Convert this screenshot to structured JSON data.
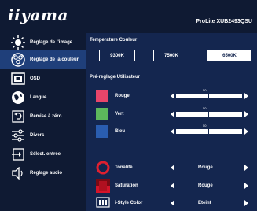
{
  "header": {
    "logo": "iiyama",
    "model": "ProLite XUB2493QSU"
  },
  "sidebar": {
    "items": [
      {
        "label": "Réglage de l'image",
        "icon": "brightness-icon",
        "active": false
      },
      {
        "label": "Réglage de la couleur",
        "icon": "color-palette-icon",
        "active": true
      },
      {
        "label": "OSD",
        "icon": "osd-icon",
        "active": false
      },
      {
        "label": "Langue",
        "icon": "globe-icon",
        "active": false
      },
      {
        "label": "Remise à zéro",
        "icon": "reset-icon",
        "active": false
      },
      {
        "label": "Divers",
        "icon": "sliders-icon",
        "active": false
      },
      {
        "label": "Sélect. entrée",
        "icon": "input-select-icon",
        "active": false
      },
      {
        "label": "Réglage audio",
        "icon": "speaker-icon",
        "active": false
      }
    ]
  },
  "main": {
    "temp_title": "Temperature Couleur",
    "temp_options": [
      {
        "label": "9300K",
        "selected": false
      },
      {
        "label": "7500K",
        "selected": false
      },
      {
        "label": "6500K",
        "selected": true
      }
    ],
    "user_title": "Pré-reglage Utilisateur",
    "rgb": [
      {
        "label": "Rouge",
        "value": "50",
        "color": "#e8456a"
      },
      {
        "label": "Vert",
        "value": "50",
        "color": "#5cb85c"
      },
      {
        "label": "Bleu",
        "value": "50",
        "color": "#2a5db0"
      }
    ],
    "options": [
      {
        "label": "Tonalité",
        "value": "Rouge",
        "icon": "hue-ring-icon"
      },
      {
        "label": "Saturation",
        "value": "Rouge",
        "icon": "saturation-icon"
      },
      {
        "label": "i-Style Color",
        "value": "Eteint",
        "icon": "i-style-icon"
      }
    ]
  },
  "colors": {
    "background": "#0f1a33",
    "panel": "#14264f",
    "active": "#1f3f7a"
  }
}
